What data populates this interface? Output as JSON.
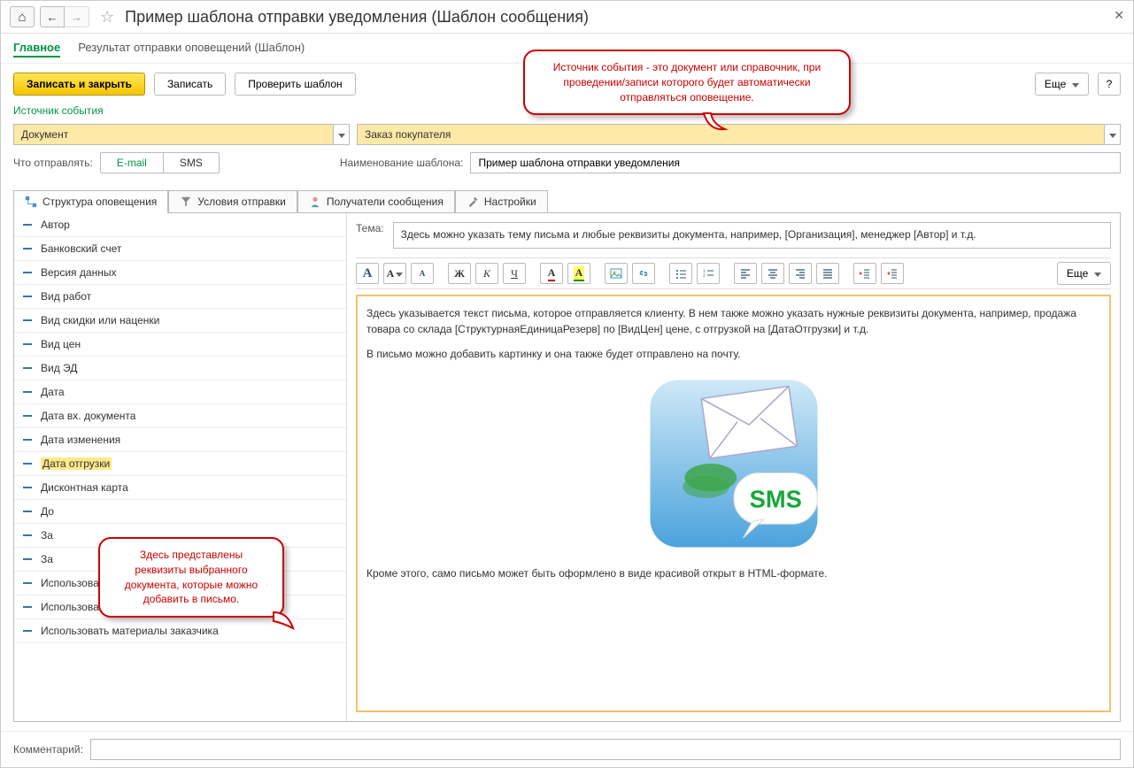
{
  "title": "Пример шаблона отправки уведомления (Шаблон сообщения)",
  "nav": {
    "main": "Главное",
    "results": "Результат отправки оповещений (Шаблон)"
  },
  "toolbar": {
    "save_close": "Записать и закрыть",
    "save": "Записать",
    "check": "Проверить шаблон",
    "more": "Еще",
    "help": "?"
  },
  "source": {
    "label": "Источник события",
    "type": "Документ",
    "object": "Заказ покупателя"
  },
  "send": {
    "label": "Что отправлять:",
    "email": "E-mail",
    "sms": "SMS"
  },
  "name": {
    "label": "Наименование шаблона:",
    "value": "Пример шаблона отправки уведомления"
  },
  "tabs": {
    "structure": "Структура оповещения",
    "conditions": "Условия отправки",
    "recipients": "Получатели сообщения",
    "settings": "Настройки"
  },
  "attrs": [
    "Автор",
    "Банковский счет",
    "Версия данных",
    "Вид работ",
    "Вид скидки или наценки",
    "Вид цен",
    "Вид ЭД",
    "Дата",
    "Дата вх. документа",
    "Дата изменения",
    "Дата отгрузки",
    "Дисконтная карта",
    "До",
    "За",
    "За",
    "Использовать зарплата исполнителей",
    "Использовать материалы",
    "Использовать материалы заказчика"
  ],
  "attr_highlight_index": 10,
  "subject": {
    "label": "Тема:",
    "value": "Здесь можно указать тему письма и любые реквизиты документа, например, [Организация], менеджер [Автор] и т.д."
  },
  "editor": {
    "more": "Еще",
    "icons": [
      "font-size-up",
      "font-family",
      "font-size-down",
      "bold",
      "italic",
      "underline",
      "font-color",
      "bg-color",
      "insert-image",
      "insert-link",
      "list-bullet",
      "list-number",
      "align-left",
      "align-center",
      "align-right",
      "align-justify",
      "outdent",
      "indent"
    ],
    "para1": "Здесь указывается текст письма, которое отправляется клиенту. В нем также можно указать нужные реквизиты документа, например, продажа товара со склада [СтруктурнаяЕдиницаРезерв] по [ВидЦен] цене, с отгрузкой на [ДатаОтгрузки] и т.д.",
    "para2": "В письмо можно добавить картинку и она также будет отправлено на почту.",
    "para3": "Кроме этого, само письмо может быть оформлено в виде красивой открыт в HTML-формате."
  },
  "comment": {
    "label": "Комментарий:"
  },
  "callouts": {
    "top": "Источник события - это документ или справочник, при проведении/записи которого будет автоматически отправляться оповещение.",
    "left": "Здесь представлены реквизиты выбранного документа, которые можно добавить в письмо."
  }
}
